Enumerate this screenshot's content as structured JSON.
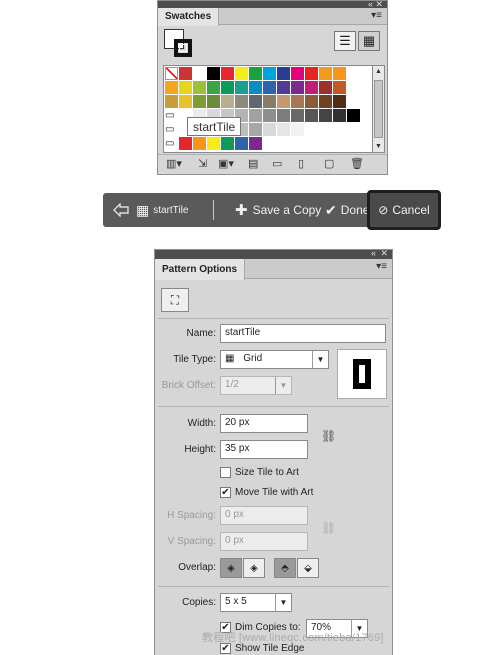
{
  "swatches": {
    "tab_title": "Swatches",
    "tooltip": "startTile",
    "rows": [
      [
        "none",
        "#cc3333",
        "#ffffff",
        "#000000",
        "#e8262d",
        "#f7ec13",
        "#19a33f",
        "#00a3da",
        "#2b3c95",
        "#e3007a",
        "#e7231e",
        "#f29a1d",
        "#f6961e"
      ],
      [
        "#f4a51e",
        "#e5d61c",
        "#9ebf3a",
        "#3ca346",
        "#0b9b5a",
        "#1a9e8f",
        "#0a8dc6",
        "#2d62ad",
        "#523b95",
        "#7b2a8b",
        "#bd1f79",
        "#9d2f2c",
        "#c25a26"
      ],
      [
        "#c69c3d",
        "#e8c22d",
        "#7d9c34",
        "#6c8c3b",
        "#b8ad8c",
        "#8d8a7a",
        "#5f6870",
        "#8b7b65",
        "#c59a70",
        "#a67757",
        "#8c5a39",
        "#6e4224",
        "#4f2d17"
      ],
      [
        "#ffffff",
        "#ebebeb",
        "#d9d9d9",
        "#c6c6c6",
        "#b4b4b4",
        "#a1a1a1",
        "#8e8e8e",
        "#7c7c7c",
        "#696969",
        "#565656",
        "#444444",
        "#313131",
        "#000000"
      ],
      [
        "#ffffff",
        "#111111",
        "#e2e2e2",
        "#cfcfcf",
        "#bdbdbd",
        "#a7a7a7",
        "#d9d9d9",
        "#e6e6e6",
        "#f2f2f2"
      ],
      [
        "#e6262d",
        "#f4951e",
        "#f7ec13",
        "#0b9b5a",
        "#2d62ad",
        "#7b2a8b"
      ]
    ]
  },
  "isolation": {
    "layer_name": "startTile",
    "save_copy": "Save a Copy",
    "done": "Done",
    "cancel": "Cancel"
  },
  "pattern": {
    "tab_title": "Pattern Options",
    "name_label": "Name:",
    "name_value": "startTile",
    "tile_type_label": "Tile Type:",
    "tile_type_value": "Grid",
    "brick_offset_label": "Brick Offset:",
    "brick_offset_value": "1/2",
    "width_label": "Width:",
    "width_value": "20 px",
    "height_label": "Height:",
    "height_value": "35 px",
    "size_tile_label": "Size Tile to Art",
    "size_tile_checked": false,
    "move_tile_label": "Move Tile with Art",
    "move_tile_checked": true,
    "h_spacing_label": "H Spacing:",
    "h_spacing_value": "0 px",
    "v_spacing_label": "V Spacing:",
    "v_spacing_value": "0 px",
    "overlap_label": "Overlap:",
    "copies_label": "Copies:",
    "copies_value": "5 x 5",
    "dim_copies_label": "Dim Copies to:",
    "dim_copies_value": "70%",
    "show_tile_edge_label": "Show Tile Edge"
  },
  "watermark": "教程吧  [www.lineqc.com/tieba/1769]"
}
